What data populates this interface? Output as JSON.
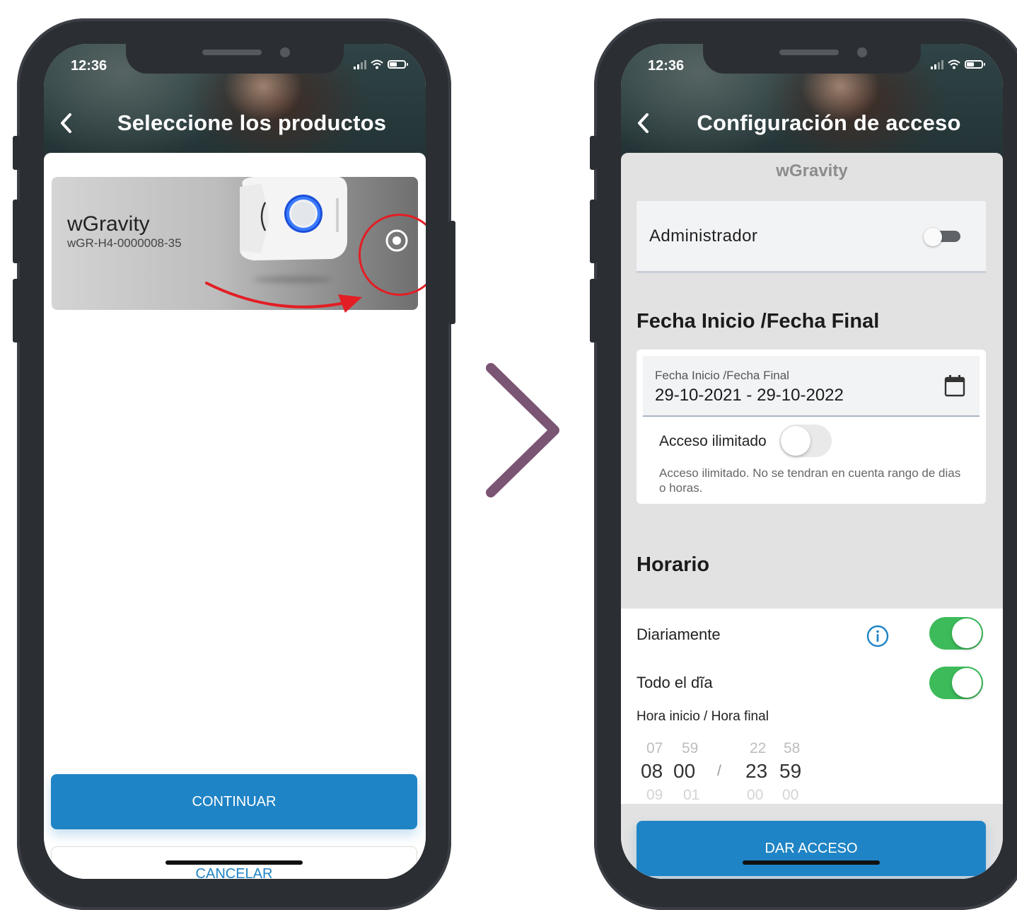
{
  "left_screen": {
    "status_time": "12:36",
    "title": "Seleccione los productos",
    "product": {
      "name": "wGravity",
      "serial": "wGR-H4-0000008-35"
    },
    "buttons": {
      "continue": "CONTINUAR",
      "cancel": "CANCELAR"
    }
  },
  "right_screen": {
    "status_time": "12:36",
    "title": "Configuración de acceso",
    "product_name": "wGravity",
    "admin": {
      "label": "Administrador",
      "enabled": false
    },
    "date_section": {
      "heading": "Fecha Inicio /Fecha Final",
      "field_label": "Fecha Inicio /Fecha Final",
      "field_value": "29-10-2021 - 29-10-2022",
      "unlimited_label": "Acceso ilimitado",
      "unlimited_enabled": false,
      "unlimited_help": "Acceso ilimitado. No se tendran en cuenta rango de dias o horas."
    },
    "schedule": {
      "heading": "Horario",
      "daily_label": "Diariamente",
      "daily_enabled": true,
      "all_day_label": "Todo el dĩa",
      "all_day_enabled": true,
      "hours_label": "Hora inicio / Hora final",
      "separator": "/",
      "start_hour": {
        "prev": "07",
        "current": "08",
        "next": "09"
      },
      "start_minute": {
        "prev": "59",
        "current": "00",
        "next": "01"
      },
      "end_hour": {
        "prev": "22",
        "current": "23",
        "next": "00"
      },
      "end_minute": {
        "prev": "58",
        "current": "59",
        "next": "00"
      }
    },
    "buttons": {
      "give_access": "DAR ACCESO"
    }
  },
  "colors": {
    "primary_blue": "#1f84c5",
    "toggle_green": "#3dbb5a",
    "annotation_red": "#e31e24",
    "chevron_purple": "#7b5574",
    "phone_frame": "#2b2e33"
  }
}
